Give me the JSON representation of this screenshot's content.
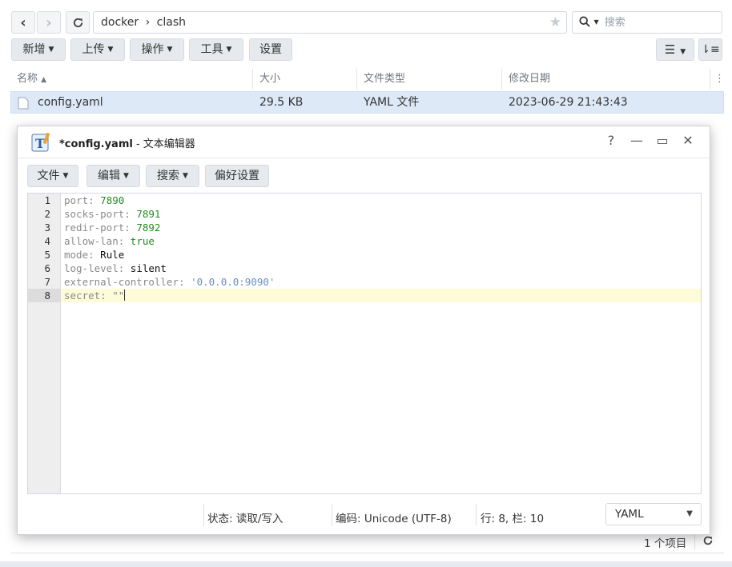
{
  "nav": {
    "back_icon": "chevron-left-icon",
    "forward_icon": "chevron-right-icon",
    "refresh_icon": "refresh-icon"
  },
  "path": {
    "segments": [
      "docker",
      "clash"
    ],
    "separator": "›"
  },
  "search": {
    "placeholder": "搜索"
  },
  "toolbar": {
    "new_label": "新增",
    "upload_label": "上传",
    "action_label": "操作",
    "tools_label": "工具",
    "settings_label": "设置"
  },
  "columns": {
    "name": "名称",
    "size": "大小",
    "type": "文件类型",
    "modified": "修改日期"
  },
  "files": [
    {
      "name": "config.yaml",
      "size": "29.5 KB",
      "type": "YAML 文件",
      "modified": "2023-06-29 21:43:43"
    }
  ],
  "footer": {
    "item_count": "1 个项目"
  },
  "editor_window": {
    "title": "*config.yaml",
    "title_suffix": " - 文本编辑器",
    "help": "?",
    "minimize": "—",
    "maximize": "▭",
    "close": "✕",
    "menu": {
      "file": "文件",
      "edit": "编辑",
      "search": "搜索",
      "prefs": "偏好设置"
    },
    "lines": [
      {
        "n": "1",
        "key": "port",
        "value": "7890",
        "kind": "num"
      },
      {
        "n": "2",
        "key": "socks-port",
        "value": "7891",
        "kind": "num"
      },
      {
        "n": "3",
        "key": "redir-port",
        "value": "7892",
        "kind": "num"
      },
      {
        "n": "4",
        "key": "allow-lan",
        "value": "true",
        "kind": "bool"
      },
      {
        "n": "5",
        "key": "mode",
        "value": "Rule",
        "kind": "plain"
      },
      {
        "n": "6",
        "key": "log-level",
        "value": "silent",
        "kind": "plain"
      },
      {
        "n": "7",
        "key": "external-controller",
        "value": "'0.0.0.0:9090'",
        "kind": "str"
      },
      {
        "n": "8",
        "key": "secret",
        "value": "\"\"",
        "kind": "pu"
      }
    ],
    "status": {
      "state": "状态: 读取/写入",
      "encoding": "编码: Unicode (UTF-8)",
      "position": "行: 8, 栏: 10",
      "mode": "YAML"
    }
  }
}
